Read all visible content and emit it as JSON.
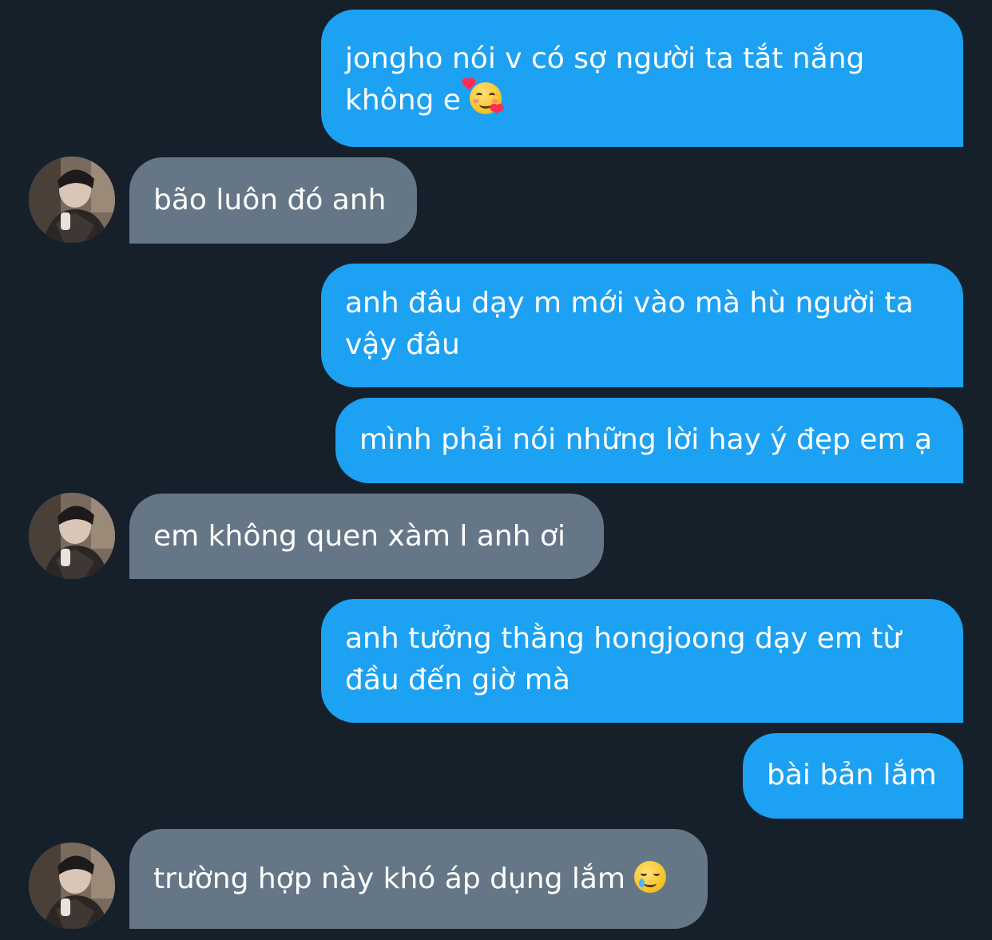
{
  "conversation": {
    "messages": [
      {
        "id": 1,
        "direction": "sent",
        "text": "jongho nói v có sợ người ta tắt nắng không e",
        "emoji": "smiling-face-with-hearts-icon"
      },
      {
        "id": 2,
        "direction": "received",
        "text": "bão luôn đó anh"
      },
      {
        "id": 3,
        "direction": "sent",
        "text": "anh đâu dạy m mới vào mà hù người ta vậy đâu"
      },
      {
        "id": 4,
        "direction": "sent",
        "text": "mình phải nói những lời hay ý đẹp em ạ"
      },
      {
        "id": 5,
        "direction": "received",
        "text": "em không quen xàm l anh ơi"
      },
      {
        "id": 6,
        "direction": "sent",
        "text": "anh tưởng thằng hongjoong dạy em từ đầu đến giờ mà"
      },
      {
        "id": 7,
        "direction": "sent",
        "text": "bài bản lắm"
      },
      {
        "id": 8,
        "direction": "received",
        "text": "trường hợp này khó áp dụng lắm",
        "emoji": "smiling-face-with-tear-icon"
      }
    ]
  },
  "colors": {
    "background": "#15202b",
    "sent_bubble": "#1da1f2",
    "received_bubble": "#657786",
    "text": "#ffffff"
  }
}
